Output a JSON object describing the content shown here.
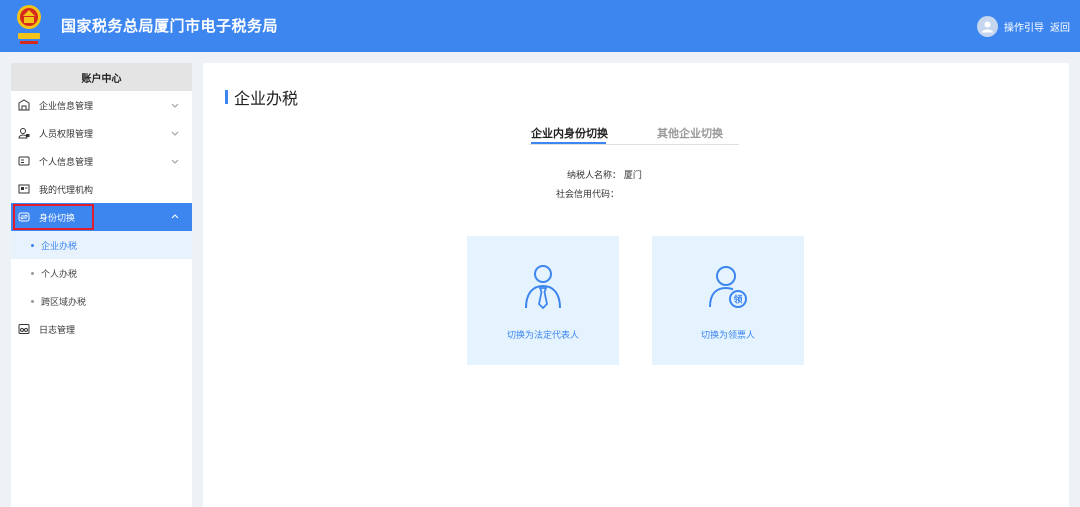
{
  "header": {
    "title": "国家税务总局厦门市电子税务局",
    "guide_label": "操作引导",
    "back_label": "返回",
    "bg_color": "#3d86f0"
  },
  "sidebar": {
    "heading": "账户中心",
    "items": [
      {
        "label": "企业信息管理",
        "icon": "building-icon",
        "expandable": true
      },
      {
        "label": "人员权限管理",
        "icon": "people-lock-icon",
        "expandable": true
      },
      {
        "label": "个人信息管理",
        "icon": "id-card-icon",
        "expandable": true
      },
      {
        "label": "我的代理机构",
        "icon": "agency-icon",
        "expandable": false
      },
      {
        "label": "身份切换",
        "icon": "switch-icon",
        "expandable": true,
        "active": true
      },
      {
        "label": "日志管理",
        "icon": "log-icon",
        "expandable": false
      }
    ],
    "sub_items": [
      {
        "label": "企业办税",
        "selected": true
      },
      {
        "label": "个人办税",
        "selected": false
      },
      {
        "label": "跨区域办税",
        "selected": false
      }
    ]
  },
  "main": {
    "title": "企业办税",
    "tabs": [
      {
        "label": "企业内身份切换",
        "active": true
      },
      {
        "label": "其他企业切换",
        "active": false
      }
    ],
    "info": {
      "taxpayer_label": "纳税人名称：",
      "taxpayer_value": "厦门",
      "credit_code_label": "社会信用代码："
    },
    "cards": [
      {
        "label": "切换为法定代表人",
        "icon": "legal-representative-icon"
      },
      {
        "label": "切换为领票人",
        "icon": "invoice-receiver-icon"
      }
    ]
  }
}
